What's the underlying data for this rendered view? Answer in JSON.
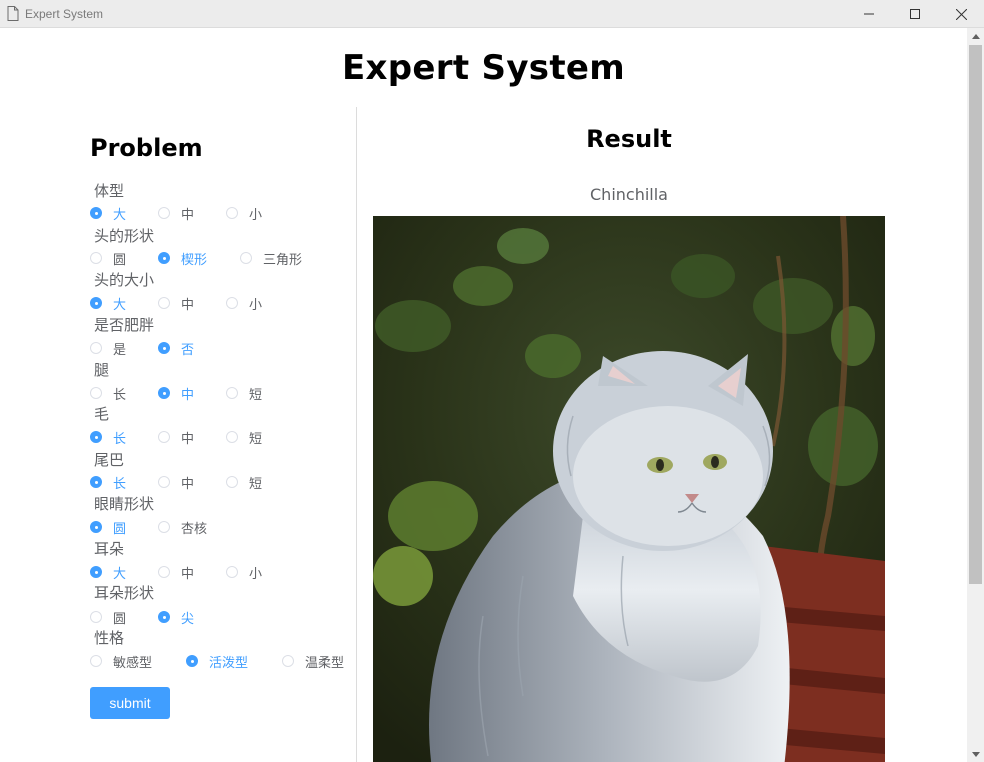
{
  "window": {
    "title": "Expert System"
  },
  "page": {
    "title": "Expert System"
  },
  "problem": {
    "heading": "Problem",
    "questions": [
      {
        "label": "体型",
        "options": [
          "大",
          "中",
          "小"
        ],
        "selected": "大"
      },
      {
        "label": "头的形状",
        "options": [
          "圆",
          "楔形",
          "三角形"
        ],
        "selected": "楔形"
      },
      {
        "label": "头的大小",
        "options": [
          "大",
          "中",
          "小"
        ],
        "selected": "大"
      },
      {
        "label": "是否肥胖",
        "options": [
          "是",
          "否"
        ],
        "selected": "否"
      },
      {
        "label": "腿",
        "options": [
          "长",
          "中",
          "短"
        ],
        "selected": "中"
      },
      {
        "label": "毛",
        "options": [
          "长",
          "中",
          "短"
        ],
        "selected": "长"
      },
      {
        "label": "尾巴",
        "options": [
          "长",
          "中",
          "短"
        ],
        "selected": "长"
      },
      {
        "label": "眼睛形状",
        "options": [
          "圆",
          "杏核"
        ],
        "selected": "圆"
      },
      {
        "label": "耳朵",
        "options": [
          "大",
          "中",
          "小"
        ],
        "selected": "大"
      },
      {
        "label": "耳朵形状",
        "options": [
          "圆",
          "尖"
        ],
        "selected": "尖"
      },
      {
        "label": "性格",
        "options": [
          "敏感型",
          "活泼型",
          "温柔型"
        ],
        "selected": "活泼型"
      }
    ],
    "submit_label": "submit"
  },
  "result": {
    "heading": "Result",
    "breed": "Chinchilla"
  },
  "colors": {
    "accent": "#409eff",
    "text": "#606266"
  }
}
